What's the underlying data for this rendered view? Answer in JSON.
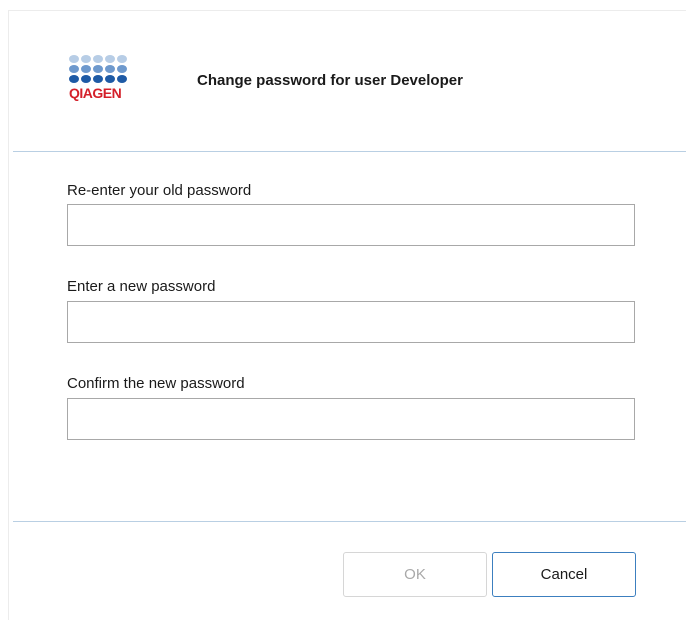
{
  "dialog": {
    "title": "Change password for user Developer",
    "logo": {
      "text": "QIAGEN",
      "text_color": "#d4202a",
      "dot_colors": [
        "#b7cde6",
        "#6e99cd",
        "#1e5aa5"
      ]
    }
  },
  "fields": {
    "old_password": {
      "label": "Re-enter your old password",
      "value": ""
    },
    "new_password": {
      "label": "Enter a new password",
      "value": ""
    },
    "confirm_password": {
      "label": "Confirm the new password",
      "value": ""
    }
  },
  "buttons": {
    "ok_label": "OK",
    "ok_enabled": false,
    "cancel_label": "Cancel"
  },
  "colors": {
    "divider": "#b9cfe3",
    "cancel_border": "#3c7fbf",
    "disabled_text": "#a9a9a9"
  }
}
